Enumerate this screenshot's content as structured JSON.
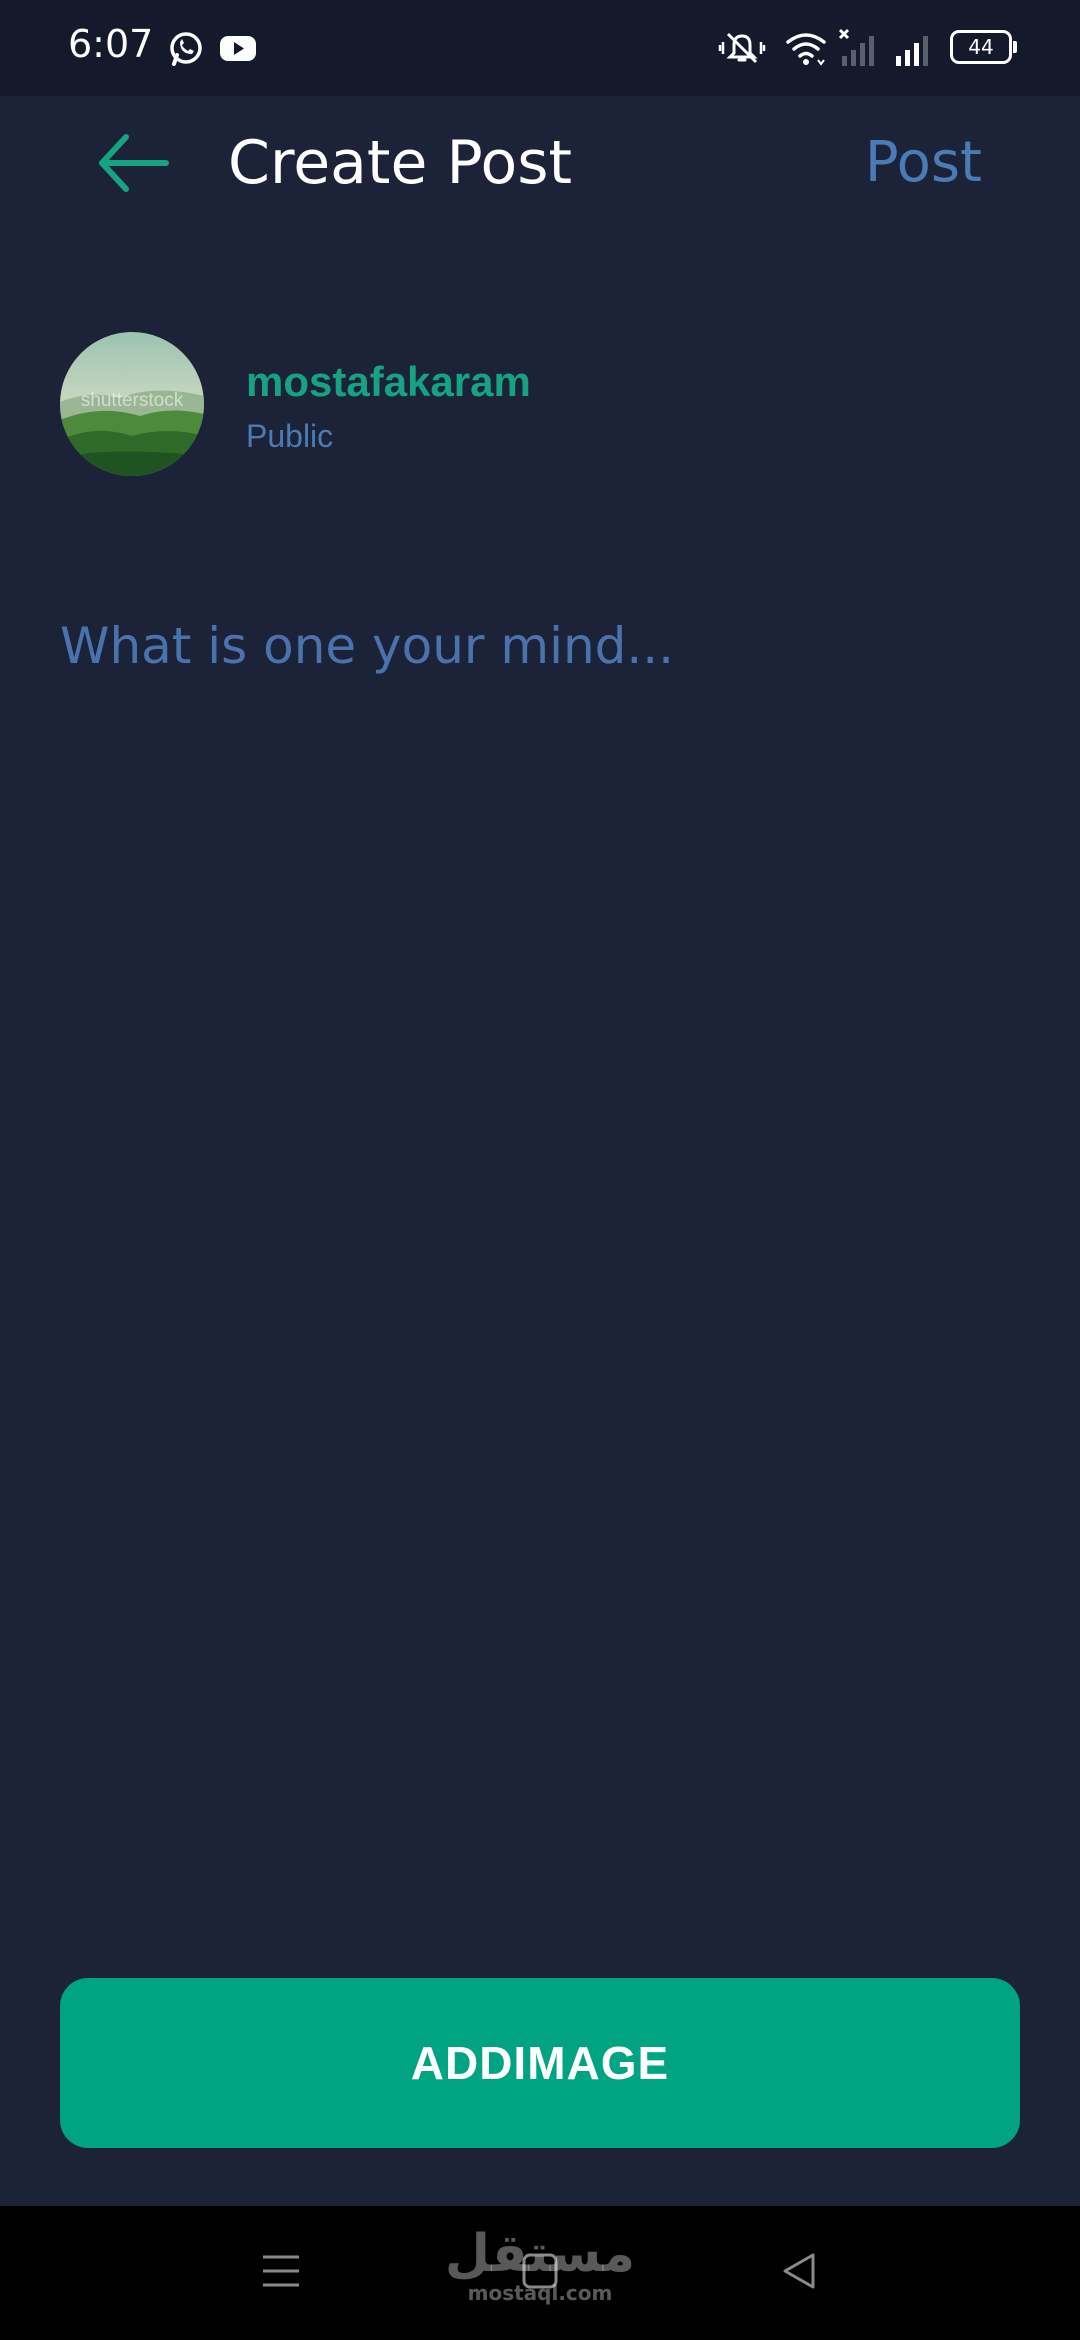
{
  "status_bar": {
    "time": "6:07",
    "battery_level": "44",
    "icons": [
      "whatsapp-icon",
      "youtube-icon",
      "vibrate-icon",
      "wifi-icon",
      "no-signal-icon",
      "signal-icon",
      "battery-icon"
    ]
  },
  "header": {
    "back_icon": "arrow-left-icon",
    "title": "Create Post",
    "post_label": "Post"
  },
  "user": {
    "name": "mostafakaram",
    "visibility": "Public",
    "avatar_watermark": "shutterstock"
  },
  "composer": {
    "placeholder": "What is one your mind...",
    "value": ""
  },
  "actions": {
    "add_image_label": "ADDIMAGE"
  },
  "navigation": {
    "buttons": [
      "menu-icon",
      "home-icon",
      "back-triangle-icon"
    ],
    "watermark_arabic": "مستقل",
    "watermark_latin": "mostaql.com"
  },
  "colors": {
    "background": "#1c2237",
    "status_bar": "#141a2c",
    "accent_green": "#00a382",
    "username_green": "#16a383",
    "muted_blue": "#4a7bb5"
  }
}
